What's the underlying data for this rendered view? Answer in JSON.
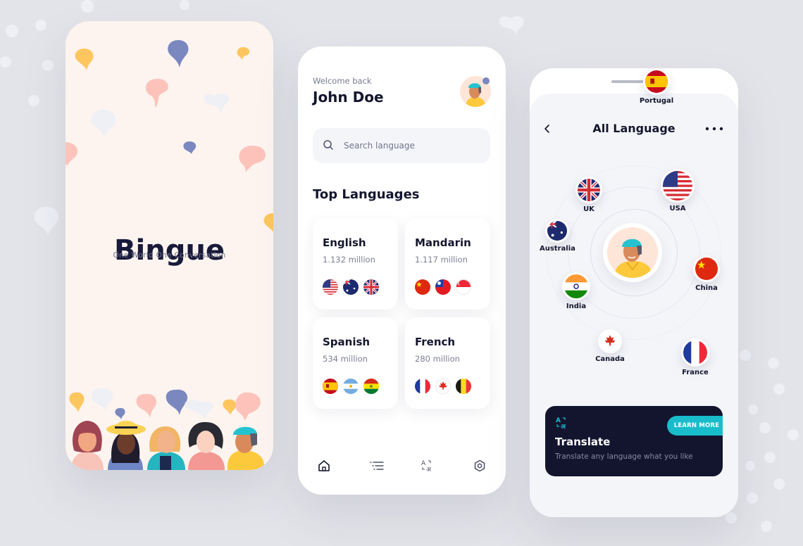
{
  "splash": {
    "app_name": "Bingue",
    "tagline": "One World One Conversation"
  },
  "home": {
    "welcome": "Welcome back",
    "user_name": "John Doe",
    "search": {
      "placeholder": "Search language",
      "value": ""
    },
    "section_title": "Top Languages",
    "languages": [
      {
        "name": "English",
        "speakers": "1.132 million",
        "flags": [
          "us-flag",
          "australia-flag",
          "uk-flag"
        ]
      },
      {
        "name": "Mandarin",
        "speakers": "1.117 million",
        "flags": [
          "china-flag",
          "taiwan-flag",
          "singapore-flag"
        ]
      },
      {
        "name": "Spanish",
        "speakers": "534 million",
        "flags": [
          "spain-flag",
          "argentina-flag",
          "bolivia-flag"
        ]
      },
      {
        "name": "French",
        "speakers": "280 million",
        "flags": [
          "france-flag",
          "canada-flag",
          "belgium-flag"
        ]
      }
    ],
    "nav": [
      {
        "icon": "home-icon",
        "active": true
      },
      {
        "icon": "list-icon",
        "active": false
      },
      {
        "icon": "translate-icon",
        "active": false
      },
      {
        "icon": "settings-icon",
        "active": false
      }
    ]
  },
  "all_language": {
    "title": "All Language",
    "countries": [
      {
        "name": "UK",
        "flag": "uk-flag"
      },
      {
        "name": "USA",
        "flag": "us-flag"
      },
      {
        "name": "Australia",
        "flag": "australia-flag"
      },
      {
        "name": "China",
        "flag": "china-flag"
      },
      {
        "name": "India",
        "flag": "india-flag"
      },
      {
        "name": "Portugal",
        "flag": "spain-flag"
      },
      {
        "name": "Canada",
        "flag": "canada-flag"
      },
      {
        "name": "France",
        "flag": "france-flag"
      }
    ],
    "promo": {
      "title": "Translate",
      "subtitle": "Translate any language what you like",
      "button": "LEARN MORE"
    }
  },
  "colors": {
    "background": "#e3e4e9",
    "splash_bg": "#fdf4ef",
    "ink": "#14162e",
    "accent_teal": "#18bccb",
    "promo_bg": "#13152f",
    "notification_dot": "#7a86c2"
  }
}
